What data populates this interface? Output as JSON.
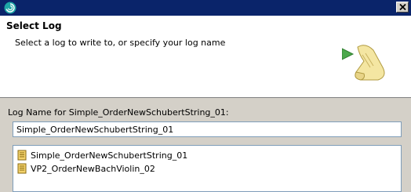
{
  "dialog": {
    "close_icon": "close-icon",
    "app_icon": "eclipse-spiral-icon"
  },
  "header": {
    "title": "Select Log",
    "description": "Select a log to write to, or specify your log name",
    "graphic": "scroll-arrow-icon"
  },
  "form": {
    "name_label": "Log Name for Simple_OrderNewSchubertString_01:",
    "name_value": "Simple_OrderNewSchubertString_01"
  },
  "logs": [
    {
      "label": "Simple_OrderNewSchubertString_01",
      "icon": "log-file-icon"
    },
    {
      "label": "VP2_OrderNewBachViolin_02",
      "icon": "log-file-icon"
    }
  ],
  "colors": {
    "titlebar": "#0a246a",
    "dialog_bg": "#d4d0c8",
    "input_border": "#7f9db9"
  }
}
